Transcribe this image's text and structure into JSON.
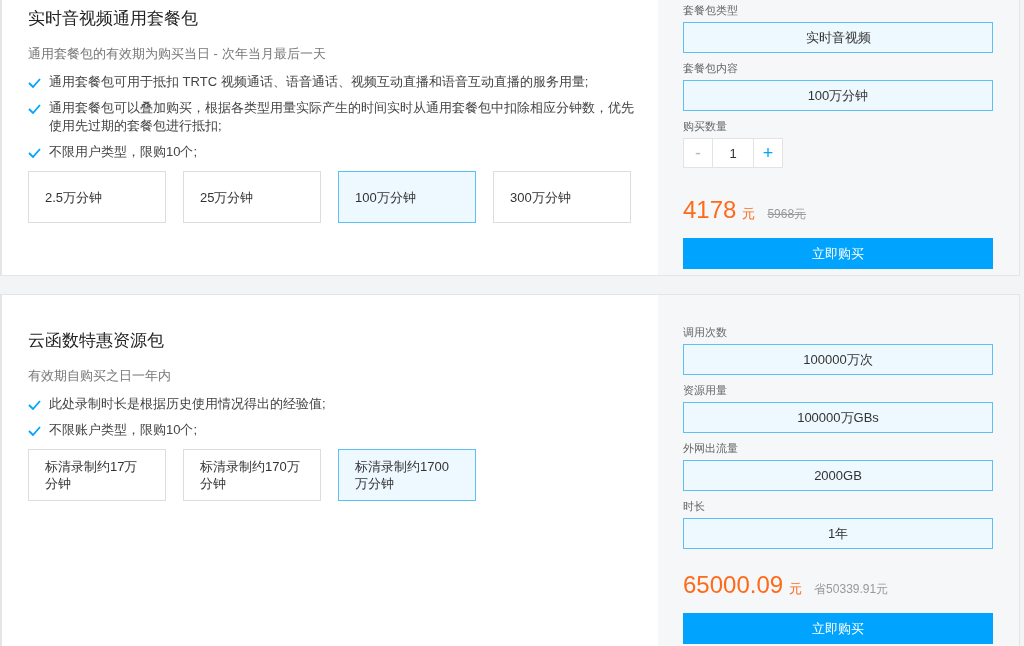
{
  "packages": [
    {
      "title": "实时音视频通用套餐包",
      "description": "通用套餐包的有效期为购买当日 - 次年当月最后一天",
      "features": [
        "通用套餐包可用于抵扣 TRTC 视频通话、语音通话、视频互动直播和语音互动直播的服务用量;",
        "通用套餐包可以叠加购买，根据各类型用量实际产生的时间实时从通用套餐包中扣除相应分钟数，优先使用先过期的套餐包进行抵扣;",
        "不限用户类型，限购10个;"
      ],
      "options": [
        {
          "label": "2.5万分钟",
          "selected": false
        },
        {
          "label": "25万分钟",
          "selected": false
        },
        {
          "label": "100万分钟",
          "selected": true
        },
        {
          "label": "300万分钟",
          "selected": false
        }
      ],
      "specs": [
        {
          "label": "套餐包类型",
          "value": "实时音视频"
        },
        {
          "label": "套餐包内容",
          "value": "100万分钟"
        }
      ],
      "quantity": {
        "label": "购买数量",
        "minus": "-",
        "value": "1",
        "plus": "+"
      },
      "price": {
        "amount": "4178",
        "unit": "元",
        "secondary": {
          "kind": "strikethrough",
          "text": "5968元"
        }
      },
      "buy_button": "立即购买"
    },
    {
      "title": "云函数特惠资源包",
      "description": "有效期自购买之日一年内",
      "features": [
        "此处录制时长是根据历史使用情况得出的经验值;",
        "不限账户类型，限购10个;"
      ],
      "options": [
        {
          "label": "标清录制约17万分钟",
          "selected": false
        },
        {
          "label": "标清录制约170万分钟",
          "selected": false
        },
        {
          "label": "标清录制约1700万分钟",
          "selected": true
        }
      ],
      "specs": [
        {
          "label": "调用次数",
          "value": "100000万次"
        },
        {
          "label": "资源用量",
          "value": "100000万GBs"
        },
        {
          "label": "外网出流量",
          "value": "2000GB"
        },
        {
          "label": "时长",
          "value": "1年"
        }
      ],
      "price": {
        "amount": "65000.09",
        "unit": "元",
        "secondary": {
          "kind": "saving",
          "text": "省50339.91元"
        }
      },
      "buy_button": "立即购买"
    }
  ]
}
